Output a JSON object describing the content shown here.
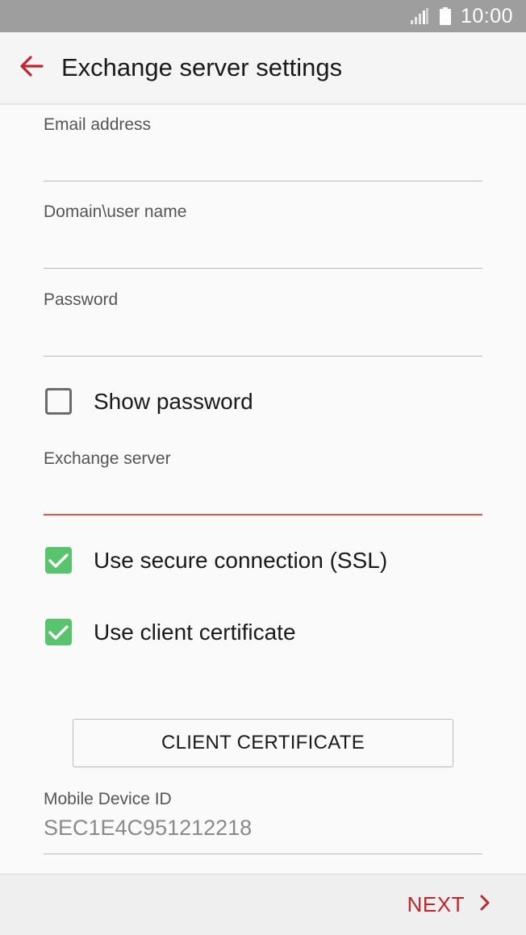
{
  "status_bar": {
    "time": "10:00",
    "signal_icon": "signal-icon",
    "battery_icon": "battery-icon"
  },
  "header": {
    "title": "Exchange server settings",
    "back_icon": "back-arrow-icon",
    "accent": "#c0262d"
  },
  "form": {
    "email": {
      "label": "Email address",
      "value": ""
    },
    "domain_user": {
      "label": "Domain\\user name",
      "value": ""
    },
    "password": {
      "label": "Password",
      "value": ""
    },
    "show_password": {
      "label": "Show password",
      "checked": false
    },
    "exchange_server": {
      "label": "Exchange server",
      "value": ""
    },
    "use_ssl": {
      "label": "Use secure connection (SSL)",
      "checked": true
    },
    "use_client_cert": {
      "label": "Use client certificate",
      "checked": true
    },
    "client_certificate_button": "CLIENT CERTIFICATE",
    "device_id": {
      "label": "Mobile Device ID",
      "value": "SEC1E4C951212218"
    }
  },
  "footer": {
    "next_label": "NEXT",
    "next_icon": "chevron-right-icon"
  },
  "colors": {
    "checkbox_on": "#5ac36d",
    "active_underline": "#e4564a",
    "status_bar": "#9e9e9e"
  }
}
